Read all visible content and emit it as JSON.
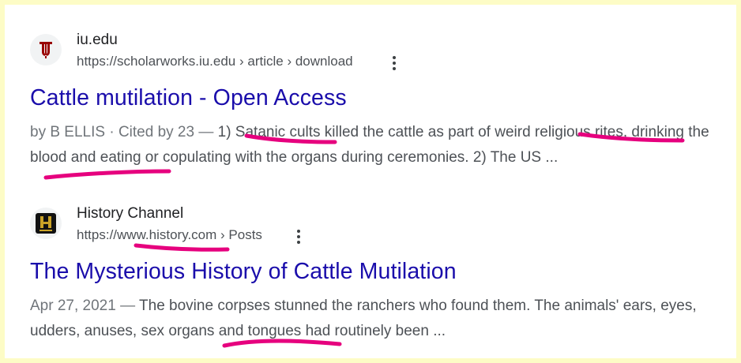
{
  "results": [
    {
      "site_name": "iu.edu",
      "url": "https://scholarworks.iu.edu › article › download",
      "title": "Cattle mutilation - Open Access",
      "snippet_meta": "by B ELLIS · Cited by 23 — ",
      "snippet_text": "1) Satanic cults killed the cattle as part of weird religious rites, drinking the blood and eating or copulating with the organs during ceremonies. 2) The US ...",
      "favicon": "iu-trident-icon",
      "favicon_color": "#990000"
    },
    {
      "site_name": "History Channel",
      "url": "https://www.history.com › Posts",
      "title": "The Mysterious History of Cattle Mutilation",
      "snippet_meta": "Apr 27, 2021 — ",
      "snippet_text": "The bovine corpses stunned the ranchers who found them. The animals' ears, eyes, udders, anuses, sex organs and tongues had routinely been ...",
      "favicon": "history-h-icon",
      "favicon_color": "#c9a227"
    }
  ],
  "colors": {
    "background": "#fdfcc6",
    "link": "#1a0dab",
    "highlight_marker": "#e6007e"
  }
}
